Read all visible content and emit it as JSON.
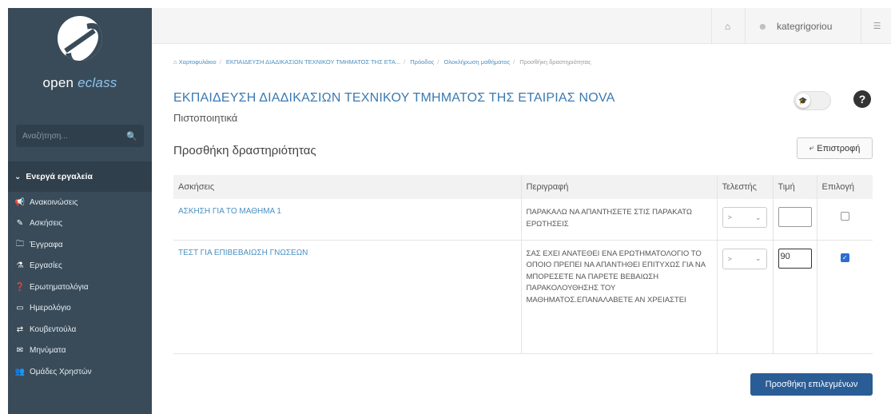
{
  "brand": {
    "name_prefix": "open ",
    "name_accent": "eclass"
  },
  "search": {
    "placeholder": "Αναζήτηση..."
  },
  "sidebar": {
    "section_label": "Ενεργά εργαλεία",
    "items": [
      {
        "label": "Ανακοινώσεις",
        "icon": "bullhorn-icon",
        "glyph": "📢"
      },
      {
        "label": "Ασκήσεις",
        "icon": "edit-icon",
        "glyph": "✎"
      },
      {
        "label": "Έγγραφα",
        "icon": "folder-icon",
        "glyph": "🗀"
      },
      {
        "label": "Εργασίες",
        "icon": "flask-icon",
        "glyph": "⚗"
      },
      {
        "label": "Ερωτηματολόγια",
        "icon": "question-icon",
        "glyph": "❓"
      },
      {
        "label": "Ημερολόγιο",
        "icon": "calendar-icon",
        "glyph": "▭"
      },
      {
        "label": "Κουβεντούλα",
        "icon": "exchange-icon",
        "glyph": "⇄"
      },
      {
        "label": "Μηνύματα",
        "icon": "envelope-icon",
        "glyph": "✉"
      },
      {
        "label": "Ομάδες Χρηστών",
        "icon": "users-icon",
        "glyph": "👥"
      }
    ]
  },
  "topbar": {
    "username": "kategrigoriou"
  },
  "breadcrumb": {
    "items": [
      "Χαρτοφυλάκιο",
      "ΕΚΠΑΙΔΕΥΣΗ ΔΙΑΔΙΚΑΣΙΩΝ ΤΕΧΝΙΚΟΥ ΤΜΗΜΑΤΟΣ ΤΗΣ ΕΤΑ...",
      "Πρόοδος",
      "Ολοκλήρωση μαθήματος"
    ],
    "current": "Προσθήκη δραστηριότητας"
  },
  "page": {
    "course_title": "ΕΚΠΑΙΔΕΥΣΗ ΔΙΑΔΙΚΑΣΙΩΝ ΤΕΧΝΙΚΟΥ ΤΜΗΜΑΤΟΣ ΤΗΣ ΕΤΑΙΡΙΑΣ NOVA",
    "subtitle": "Πιστοποιητικά",
    "section_title": "Προσθήκη δραστηριότητας",
    "back_label": "Επιστροφή",
    "add_selected_label": "Προσθήκη επιλεγμένων"
  },
  "table": {
    "headers": [
      "Ασκήσεις",
      "Περιγραφή",
      "Τελεστής",
      "Τιμή",
      "Επιλογή"
    ],
    "rows": [
      {
        "exercise": "ΑΣΚΗΣΗ ΓΙΑ ΤΟ ΜΑΘΗΜΑ 1",
        "description": "ΠΑΡΑΚΑΛΩ ΝΑ ΑΠΑΝΤΗΣΕΤΕ ΣΤΙΣ ΠΑΡΑΚΑΤΩ ΕΡΩΤΗΣΕΙΣ",
        "operator": ">",
        "value": "",
        "selected": false
      },
      {
        "exercise": "ΤΕΣΤ ΓΙΑ ΕΠΙΒΕΒΑΙΩΣΗ ΓΝΩΣΕΩΝ",
        "description": "ΣΑΣ ΕΧΕΙ ΑΝΑΤΕΘΕΙ ΕΝΑ ΕΡΩΤΗΜΑΤΟΛΟΓΙΟ ΤΟ ΟΠΟΙΟ ΠΡΕΠΕΙ ΝΑ ΑΠΑΝΤΗΘΕΙ ΕΠΙΤΥΧΩΣ ΓΙΑ ΝΑ ΜΠΟΡΕΣΕΤΕ ΝΑ ΠΑΡΕΤΕ ΒΕΒΑΙΩΣΗ ΠΑΡΑΚΟΛΟΥΘΗΣΗΣ ΤΟΥ ΜΑΘΗΜΑΤΟΣ.ΕΠΑΝΑΛΑΒΕΤΕ ΑΝ ΧΡΕΙΑΣΤΕΙ",
        "operator": ">",
        "value": "90",
        "selected": true
      }
    ]
  },
  "colors": {
    "sidebar_bg": "#394b59",
    "link": "#4a90c0",
    "title": "#3b79b1",
    "primary_button": "#2a5d96"
  }
}
